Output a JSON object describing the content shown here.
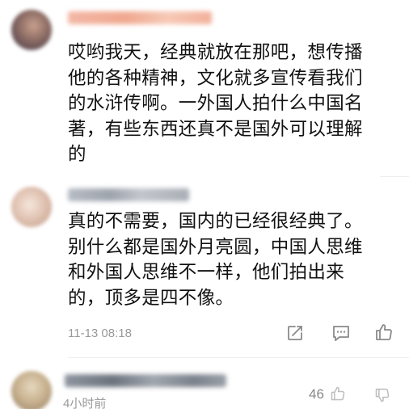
{
  "comments": [
    {
      "lines": [
        "哎哟我天，经典就放在那吧，想传播",
        "他的各种精神，文化就多宣传看我们",
        "的水浒传啊。一外国人拍什么中国名",
        "著，有些东西还真不是国外可以理解",
        "的"
      ]
    },
    {
      "lines": [
        "真的不需要，国内的已经很经典了。",
        "别什么都是国外月亮圆，中国人思维",
        "和外国人思维不一样，他们拍出来",
        "的，顶多是四不像。"
      ],
      "timestamp": "11-13 08:18"
    },
    {
      "timestamp": "4小时前",
      "like_count": "46"
    }
  ],
  "icons": {
    "share": "share-icon",
    "comment": "comment-icon",
    "like": "thumbs-up-icon"
  },
  "colors": {
    "text": "#111111",
    "meta": "#999999"
  }
}
